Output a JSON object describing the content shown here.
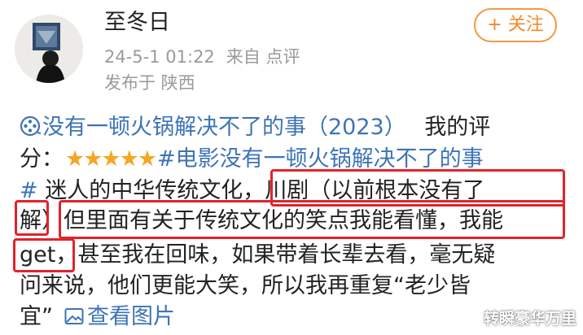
{
  "user": {
    "name": "至冬日",
    "time": "24-5-1 01:22",
    "source": "来自 点评",
    "location": "发布于 陕西"
  },
  "follow_label": "+ 关注",
  "review": {
    "line1_title": "没有一顿火锅解决不了的事（2023）",
    "line1_tail": "我的评",
    "line2_prefix": "分：",
    "stars": "★★★★★",
    "line2_tag": "#电影没有一顿火锅解决不了的事",
    "line3_hash": "#",
    "line3_text": " 迷人的中华传统文化，川剧（以前根本没有了",
    "line4_text": "解）但里面有关于传统文化的笑点我能看懂，我能",
    "line5_text": "get，甚至我在回味，如果带着长辈去看，毫无疑",
    "line6_text": "问来说，他们更能大笑，所以我再重复“老少皆",
    "line7_text": "宜”",
    "view_pics": "查看图片"
  },
  "watermark": "转瞬豪华万里",
  "colors": {
    "link": "#3e74b6",
    "star": "#f6a623",
    "follow": "#f08a2a",
    "highlight": "#e1232b",
    "meta": "#9a9a9a"
  },
  "icons": {
    "film": "film-reel-icon",
    "picture": "picture-icon"
  }
}
